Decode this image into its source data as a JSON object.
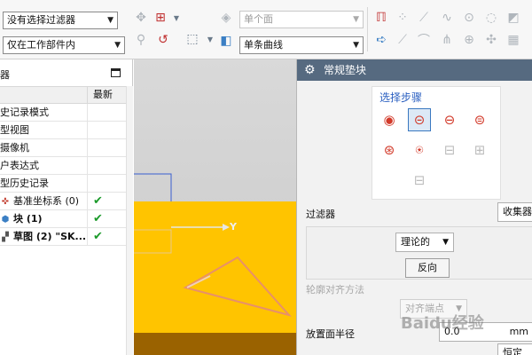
{
  "toolbar": {
    "filter_combo": "没有选择过滤器",
    "scope_combo": "仅在工作部件内",
    "face_rule_combo": "单个面",
    "curve_rule_combo": "单条曲线"
  },
  "navigator": {
    "title": "器",
    "column_latest": "最新",
    "rows": [
      {
        "name": "史记录模式",
        "latest": ""
      },
      {
        "name": "型视图",
        "latest": ""
      },
      {
        "name": "摄像机",
        "latest": ""
      },
      {
        "name": "户表达式",
        "latest": ""
      },
      {
        "name": "型历史记录",
        "latest": ""
      },
      {
        "name": "基准坐标系 (0)",
        "latest": "✔",
        "icon": "datum-csys-icon"
      },
      {
        "name": "块 (1)",
        "latest": "✔",
        "icon": "block-icon"
      },
      {
        "name": "草图 (2) \"SK...",
        "latest": "✔",
        "icon": "sketch-icon"
      }
    ]
  },
  "viewport": {
    "axis_label": "Y",
    "colors": {
      "part": "#ffc400",
      "part_bottom": "#9a6200",
      "sketch": "#e8906a"
    }
  },
  "dialog": {
    "title": "常规垫块",
    "steps_label": "选择步骤",
    "filter_label": "过滤器",
    "filter_value": "收集器",
    "type_value": "理论的",
    "reverse_button": "反向",
    "contour_align_label": "轮廓对齐方法",
    "align_value": "对齐端点",
    "radius_label": "放置面半径",
    "radius_value": "0.0",
    "radius_unit": "mm",
    "bottom_value": "恒定"
  },
  "watermark": "Baidu经验"
}
